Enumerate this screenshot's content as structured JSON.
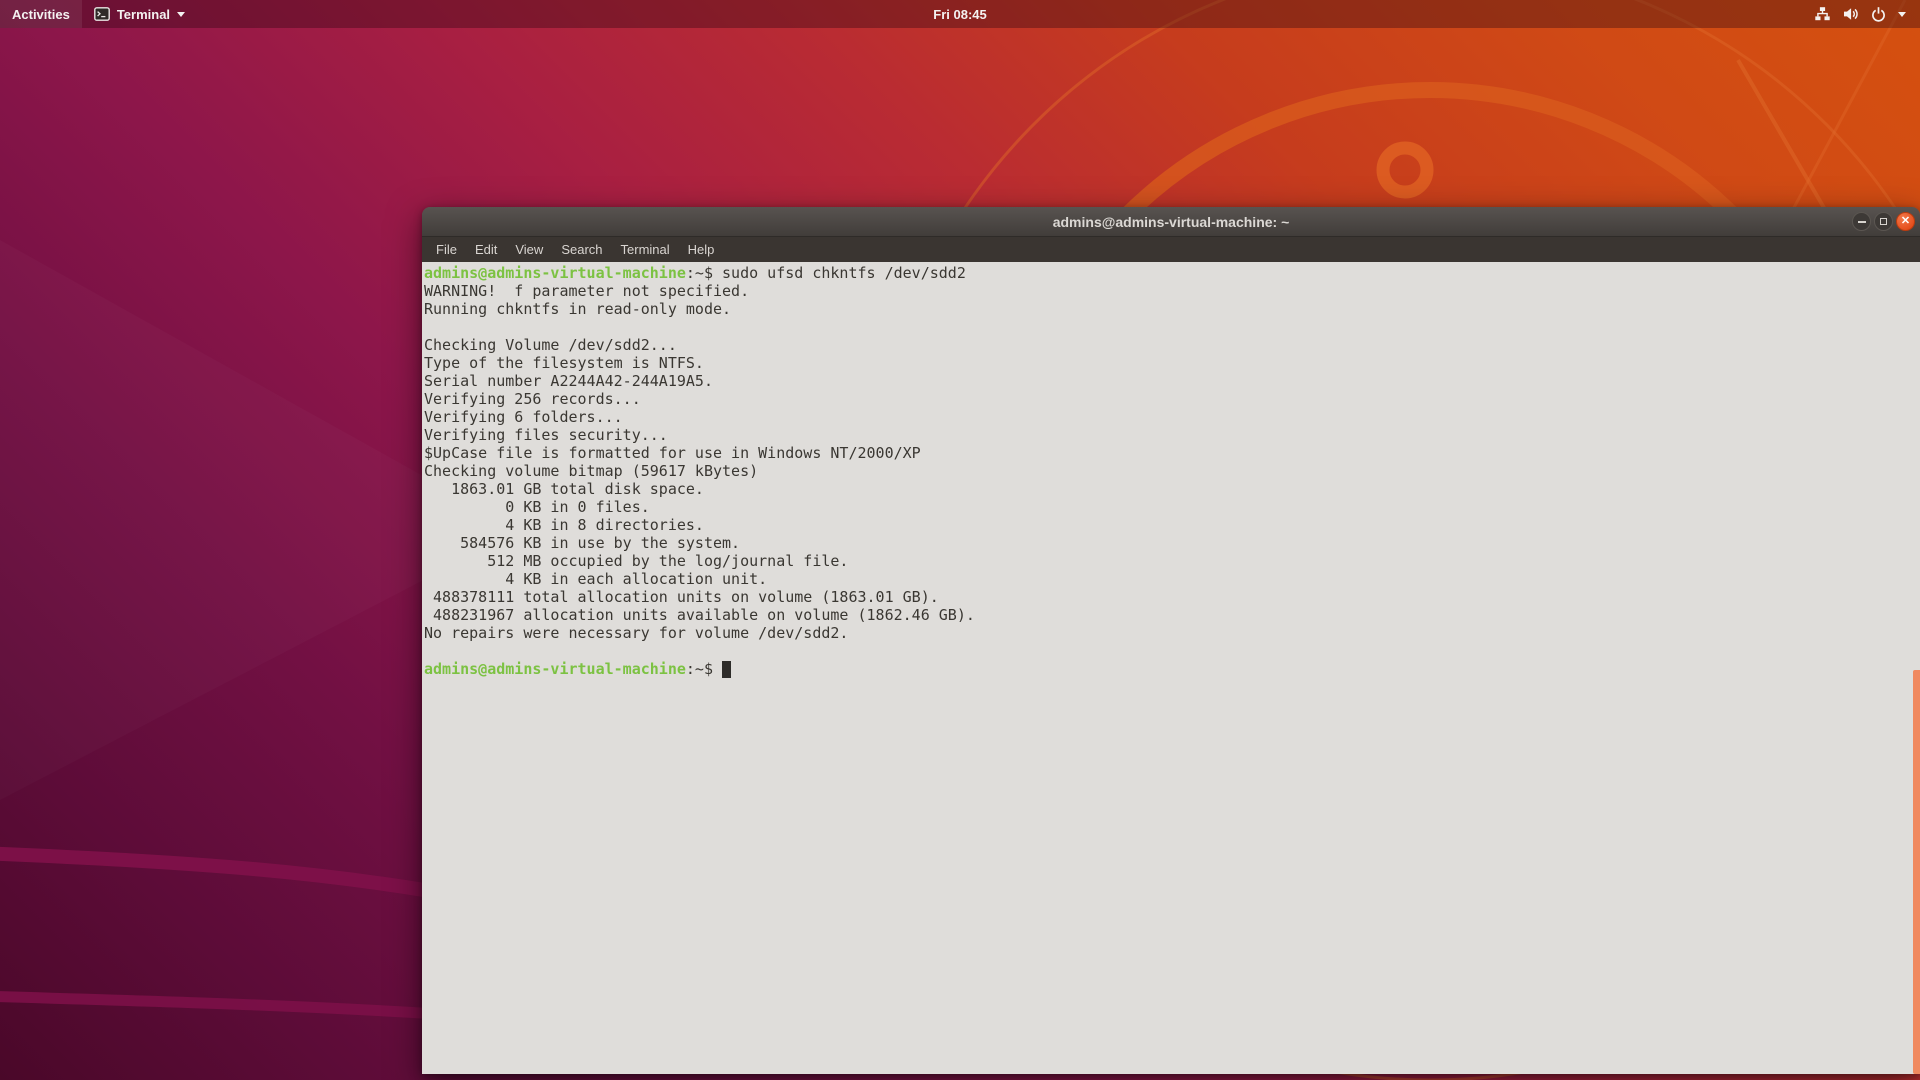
{
  "topbar": {
    "activities_label": "Activities",
    "app_menu_label": "Terminal",
    "clock": "Fri 08:45",
    "status_icons": [
      "network-icon",
      "volume-icon",
      "power-icon",
      "chevron-down-icon"
    ]
  },
  "window": {
    "title": "admins@admins-virtual-machine: ~",
    "controls": {
      "close_glyph": "✕"
    },
    "menu_items": [
      "File",
      "Edit",
      "View",
      "Search",
      "Terminal",
      "Help"
    ]
  },
  "terminal": {
    "prompt_user": "admins@admins-virtual-machine",
    "prompt_suffix": ":~$ ",
    "command": "sudo ufsd chkntfs /dev/sdd2",
    "output_lines": [
      "WARNING!  f parameter not specified.",
      "Running chkntfs in read-only mode.",
      "",
      "Checking Volume /dev/sdd2...",
      "Type of the filesystem is NTFS.",
      "Serial number A2244A42-244A19A5.",
      "Verifying 256 records...",
      "Verifying 6 folders...",
      "Verifying files security...",
      "$UpCase file is formatted for use in Windows NT/2000/XP",
      "Checking volume bitmap (59617 kBytes)",
      "   1863.01 GB total disk space.",
      "         0 KB in 0 files.",
      "         4 KB in 8 directories.",
      "    584576 KB in use by the system.",
      "       512 MB occupied by the log/journal file.",
      "         4 KB in each allocation unit.",
      " 488378111 total allocation units on volume (1863.01 GB).",
      " 488231967 allocation units available on volume (1862.46 GB).",
      "No repairs were necessary for volume /dev/sdd2.",
      ""
    ]
  },
  "colors": {
    "prompt_green": "#7cc242",
    "terminal_bg": "#dfddda",
    "terminal_text": "#3a3732",
    "titlebar_dark": "#413d3a",
    "close_button_orange": "#e8542c",
    "scrollbar_orange": "#f0895f",
    "wallpaper_orange": "#d04a15",
    "wallpaper_purple": "#5d0c38"
  }
}
